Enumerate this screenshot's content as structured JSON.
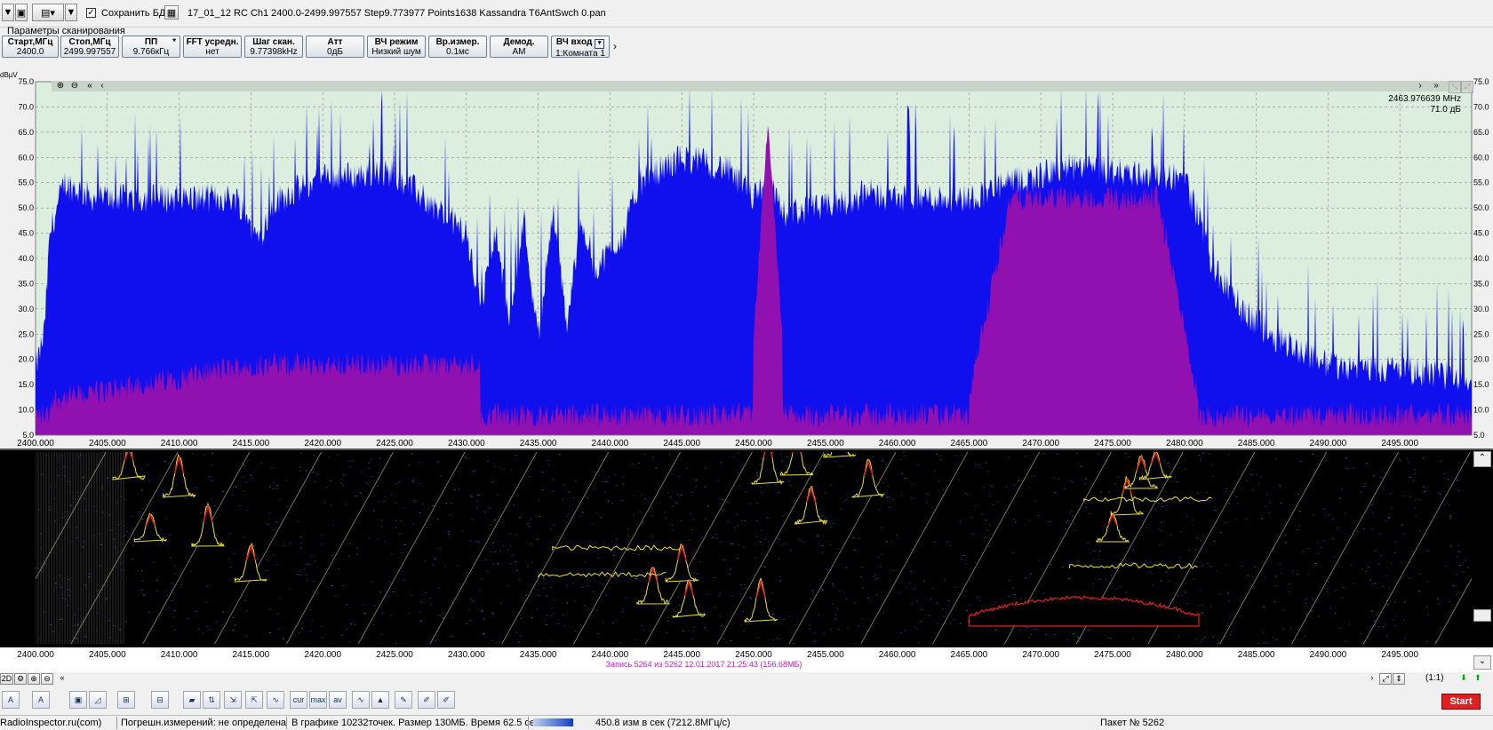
{
  "toolbar": {
    "save_db_checked": true,
    "save_db_label": "Сохранить БД",
    "file_info": "17_01_12 RC  Ch1 2400.0-2499.997557 Step9.773977 Points1638 Kassandra T6AntSwch 0.pan"
  },
  "params_label": "Параметры сканирования",
  "params": [
    {
      "title": "Старт,МГц",
      "value": "2400.0"
    },
    {
      "title": "Стоп,МГц",
      "value": "2499.997557"
    },
    {
      "title": "ПП",
      "value": "9.766кГц",
      "mark": "*"
    },
    {
      "title": "FFT усредн.",
      "value": "нет"
    },
    {
      "title": "Шаг скан.",
      "value": "9.77398kHz"
    },
    {
      "title": "Атт",
      "value": "0дБ"
    },
    {
      "title": "ВЧ режим",
      "value": "Низкий шум"
    },
    {
      "title": "Вр.измер.",
      "value": "0.1мс"
    },
    {
      "title": "Демод.",
      "value": "AM"
    },
    {
      "title": "ВЧ вход",
      "value": "1:Комната 1"
    }
  ],
  "spectrum": {
    "y_unit": "dBµV",
    "y_ticks": [
      "75.0",
      "70.0",
      "65.0",
      "60.0",
      "55.0",
      "50.0",
      "45.0",
      "40.0",
      "35.0",
      "30.0",
      "25.0",
      "20.0",
      "15.0",
      "10.0",
      "5.0"
    ],
    "x_ticks": [
      "2400.000",
      "2405.000",
      "2410.000",
      "2415.000",
      "2420.000",
      "2425.000",
      "2430.000",
      "2435.000",
      "2440.000",
      "2445.000",
      "2450.000",
      "2455.000",
      "2460.000",
      "2465.000",
      "2470.000",
      "2475.000",
      "2480.000",
      "2485.000",
      "2490.000",
      "2495.000"
    ],
    "marker_freq": "2463.976639 MHz",
    "marker_level": "71.0 дБ",
    "colors": {
      "current": "#1010ee",
      "average": "#9010b0",
      "background": "#dceedd"
    }
  },
  "waterfall": {
    "x_ticks": [
      "2400.000",
      "2405.000",
      "2410.000",
      "2415.000",
      "2420.000",
      "2425.000",
      "2430.000",
      "2435.000",
      "2440.000",
      "2445.000",
      "2450.000",
      "2455.000",
      "2460.000",
      "2465.000",
      "2470.000",
      "2475.000",
      "2480.000",
      "2485.000",
      "2490.000",
      "2495.000"
    ],
    "record_info": "Запись 5264  из 5262    12.01.2017 21:25:43  (156.68МБ)",
    "scale_label": "(1:1)"
  },
  "status": {
    "site": "RadioInspector.ru(com)",
    "error": "Погрешн.измерений: не определена",
    "graph_info": "В графике 10232точек.  Размер 130МБ. Время 62.5 сек",
    "rate": "450.8 изм в сек (7212.8МГц/с)",
    "packet": "Пакет № 5262"
  },
  "start_label": "Start",
  "view_label": "2D"
}
